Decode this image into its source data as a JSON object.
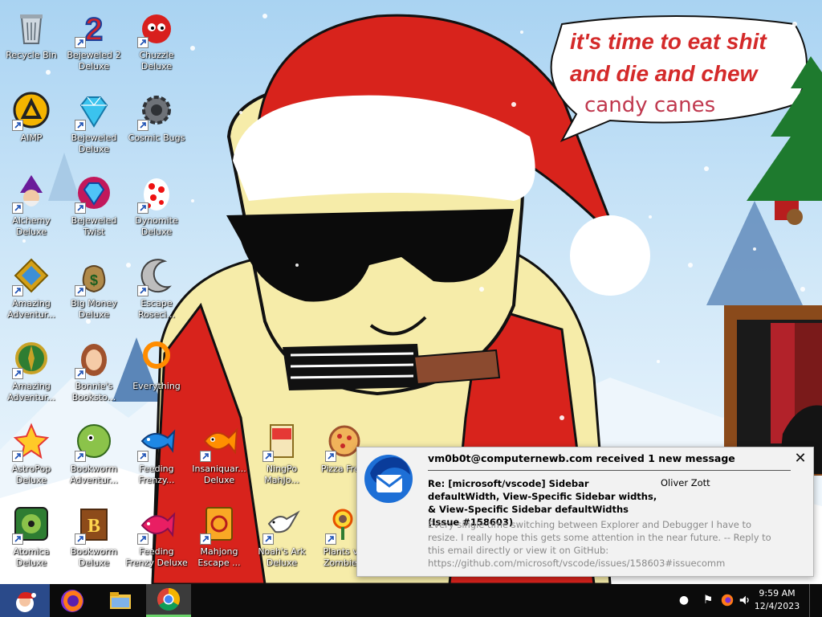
{
  "desktop": {
    "speech_bubble": {
      "line1": "it's time to eat shit",
      "line2": "and die and chew",
      "line3": "candy canes"
    },
    "icons": [
      {
        "label": "Recycle Bin",
        "icon": "recycle-bin-icon",
        "shortcut": false
      },
      {
        "label": "Bejeweled 2\nDeluxe",
        "icon": "bejeweled-2-icon",
        "shortcut": true
      },
      {
        "label": "Chuzzle\nDeluxe",
        "icon": "chuzzle-icon",
        "shortcut": true
      },
      {
        "label": "AIMP",
        "icon": "aimp-icon",
        "shortcut": true
      },
      {
        "label": "Bejeweled\nDeluxe",
        "icon": "bejeweled-icon",
        "shortcut": true
      },
      {
        "label": "Cosmic Bugs",
        "icon": "cosmic-bugs-icon",
        "shortcut": true
      },
      {
        "label": "Alchemy\nDeluxe",
        "icon": "alchemy-icon",
        "shortcut": true
      },
      {
        "label": "Bejeweled\nTwist",
        "icon": "bejeweled-twist-icon",
        "shortcut": true
      },
      {
        "label": "Dynomite\nDeluxe",
        "icon": "dynomite-icon",
        "shortcut": true
      },
      {
        "label": "Amazing\nAdventur...",
        "icon": "amazing-adventures-icon",
        "shortcut": true
      },
      {
        "label": "Big Money\nDeluxe",
        "icon": "big-money-icon",
        "shortcut": true
      },
      {
        "label": "Escape\nRoseci...",
        "icon": "escape-rosecliff-icon",
        "shortcut": true
      },
      {
        "label": "Amazing\nAdventur...",
        "icon": "amazing-adventures-2-icon",
        "shortcut": true
      },
      {
        "label": "Bonnie's\nBooksto...",
        "icon": "bonnies-bookstore-icon",
        "shortcut": true
      },
      {
        "label": "Everything",
        "icon": "everything-search-icon",
        "shortcut": false
      },
      {
        "label": "AstroPop\nDeluxe",
        "icon": "astropop-icon",
        "shortcut": true
      },
      {
        "label": "Bookworm\nAdventur...",
        "icon": "bookworm-adventures-icon",
        "shortcut": true
      },
      {
        "label": "Feeding\nFrenzy...",
        "icon": "feeding-frenzy-icon",
        "shortcut": true
      },
      {
        "label": "Insaniquar...\nDeluxe",
        "icon": "insaniquarium-icon",
        "shortcut": true
      },
      {
        "label": "NingPo\nMahJo...",
        "icon": "ningpo-mahjong-icon",
        "shortcut": true
      },
      {
        "label": "Pizza Fre...",
        "icon": "pizza-frenzy-icon",
        "shortcut": true
      },
      {
        "label": "Atomica\nDeluxe",
        "icon": "atomica-icon",
        "shortcut": true
      },
      {
        "label": "Bookworm\nDeluxe",
        "icon": "bookworm-icon",
        "shortcut": true
      },
      {
        "label": "Feeding\nFrenzy Deluxe",
        "icon": "feeding-frenzy-deluxe-icon",
        "shortcut": true
      },
      {
        "label": "Mahjong\nEscape ...",
        "icon": "mahjong-escape-icon",
        "shortcut": true
      },
      {
        "label": "Noah's Ark\nDeluxe",
        "icon": "noahs-ark-icon",
        "shortcut": true
      },
      {
        "label": "Plants v...\nZombie...",
        "icon": "plants-vs-zombies-icon",
        "shortcut": true
      }
    ]
  },
  "notification": {
    "title": "vm0b0t@computernewb.com received 1 new message",
    "subject": "Re: [microsoft/vscode] Sidebar defaultWidth, View-Specific Sidebar widths, & View-Specific Sidebar defaultWidths (Issue #158603)",
    "sender": "Oliver Zott",
    "body": "Every single time switching between Explorer and Debugger I have to resize. I really hope this gets some attention in the near future. -- Reply to this email directly or view it on GitHub: https://github.com/microsoft/vscode/issues/158603#issuecomm",
    "close_glyph": "✕",
    "app_icon": "thunderbird-icon"
  },
  "taskbar": {
    "apps": [
      {
        "name": "Firefox",
        "icon": "firefox-icon"
      },
      {
        "name": "File Explorer",
        "icon": "file-explorer-icon"
      },
      {
        "name": "Google Chrome",
        "icon": "chrome-icon",
        "active": true
      }
    ],
    "clock": {
      "time": "9:59 AM",
      "date": "12/4/2023"
    },
    "colors": {
      "background": "#0b0b0b",
      "active_indicator": "#6bd36b"
    }
  }
}
